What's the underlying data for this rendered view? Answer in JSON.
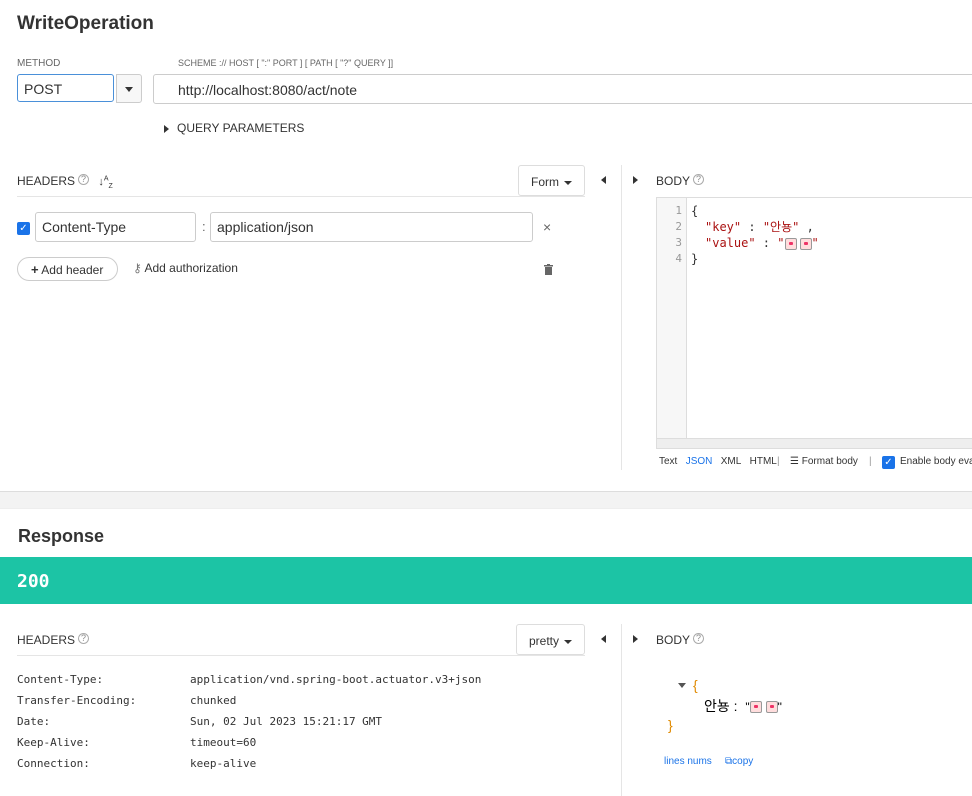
{
  "operation": {
    "title": "WriteOperation"
  },
  "request": {
    "method_label": "METHOD",
    "method": "POST",
    "url_label": "SCHEME :// HOST [ \":\" PORT ] [ PATH [ \"?\" QUERY ]]",
    "url": "http://localhost:8080/act/note",
    "query_params_label": "QUERY PARAMETERS",
    "headers_label": "HEADERS",
    "headers_mode": "Form",
    "header_row": {
      "name": "Content-Type",
      "separator": ":",
      "value": "application/json"
    },
    "add_header_label": "Add header",
    "add_auth_label": "Add authorization",
    "body_label": "BODY",
    "body_lines": [
      "1",
      "2",
      "3",
      "4"
    ],
    "body_code": {
      "line1": "{",
      "line2_key": "\"key\"",
      "line2_sep": " : ",
      "line2_val": "\"안뇽\"",
      "line2_comma": " ,",
      "line3_key": "\"value\"",
      "line3_sep": " : ",
      "line3_val_open": "\"",
      "line3_val_close": "\"",
      "line4": "}"
    },
    "body_formats": [
      "Text",
      "JSON",
      "XML",
      "HTML"
    ],
    "format_body_label": "Format body",
    "enable_eval_label": "Enable body eva"
  },
  "response": {
    "title": "Response",
    "status": "200",
    "headers_label": "HEADERS",
    "view_mode": "pretty",
    "body_label": "BODY",
    "headers": [
      {
        "name": "Content-Type:",
        "value": "application/vnd.spring-boot.actuator.v3+json"
      },
      {
        "name": "Transfer-Encoding:",
        "value": "chunked"
      },
      {
        "name": "Date:",
        "value": "Sun, 02 Jul 2023 15:21:17 GMT"
      },
      {
        "name": "Keep-Alive:",
        "value": "timeout=60"
      },
      {
        "name": "Connection:",
        "value": "keep-alive"
      }
    ],
    "body_open": "{",
    "body_key": "안뇽 :",
    "body_val_open": "\"",
    "body_val_close": "\"",
    "body_close": "}",
    "lines_nums_label": "lines nums",
    "copy_label": "copy"
  },
  "colors": {
    "status_bar": "#1cc4a5",
    "accent": "#1a73e8"
  }
}
